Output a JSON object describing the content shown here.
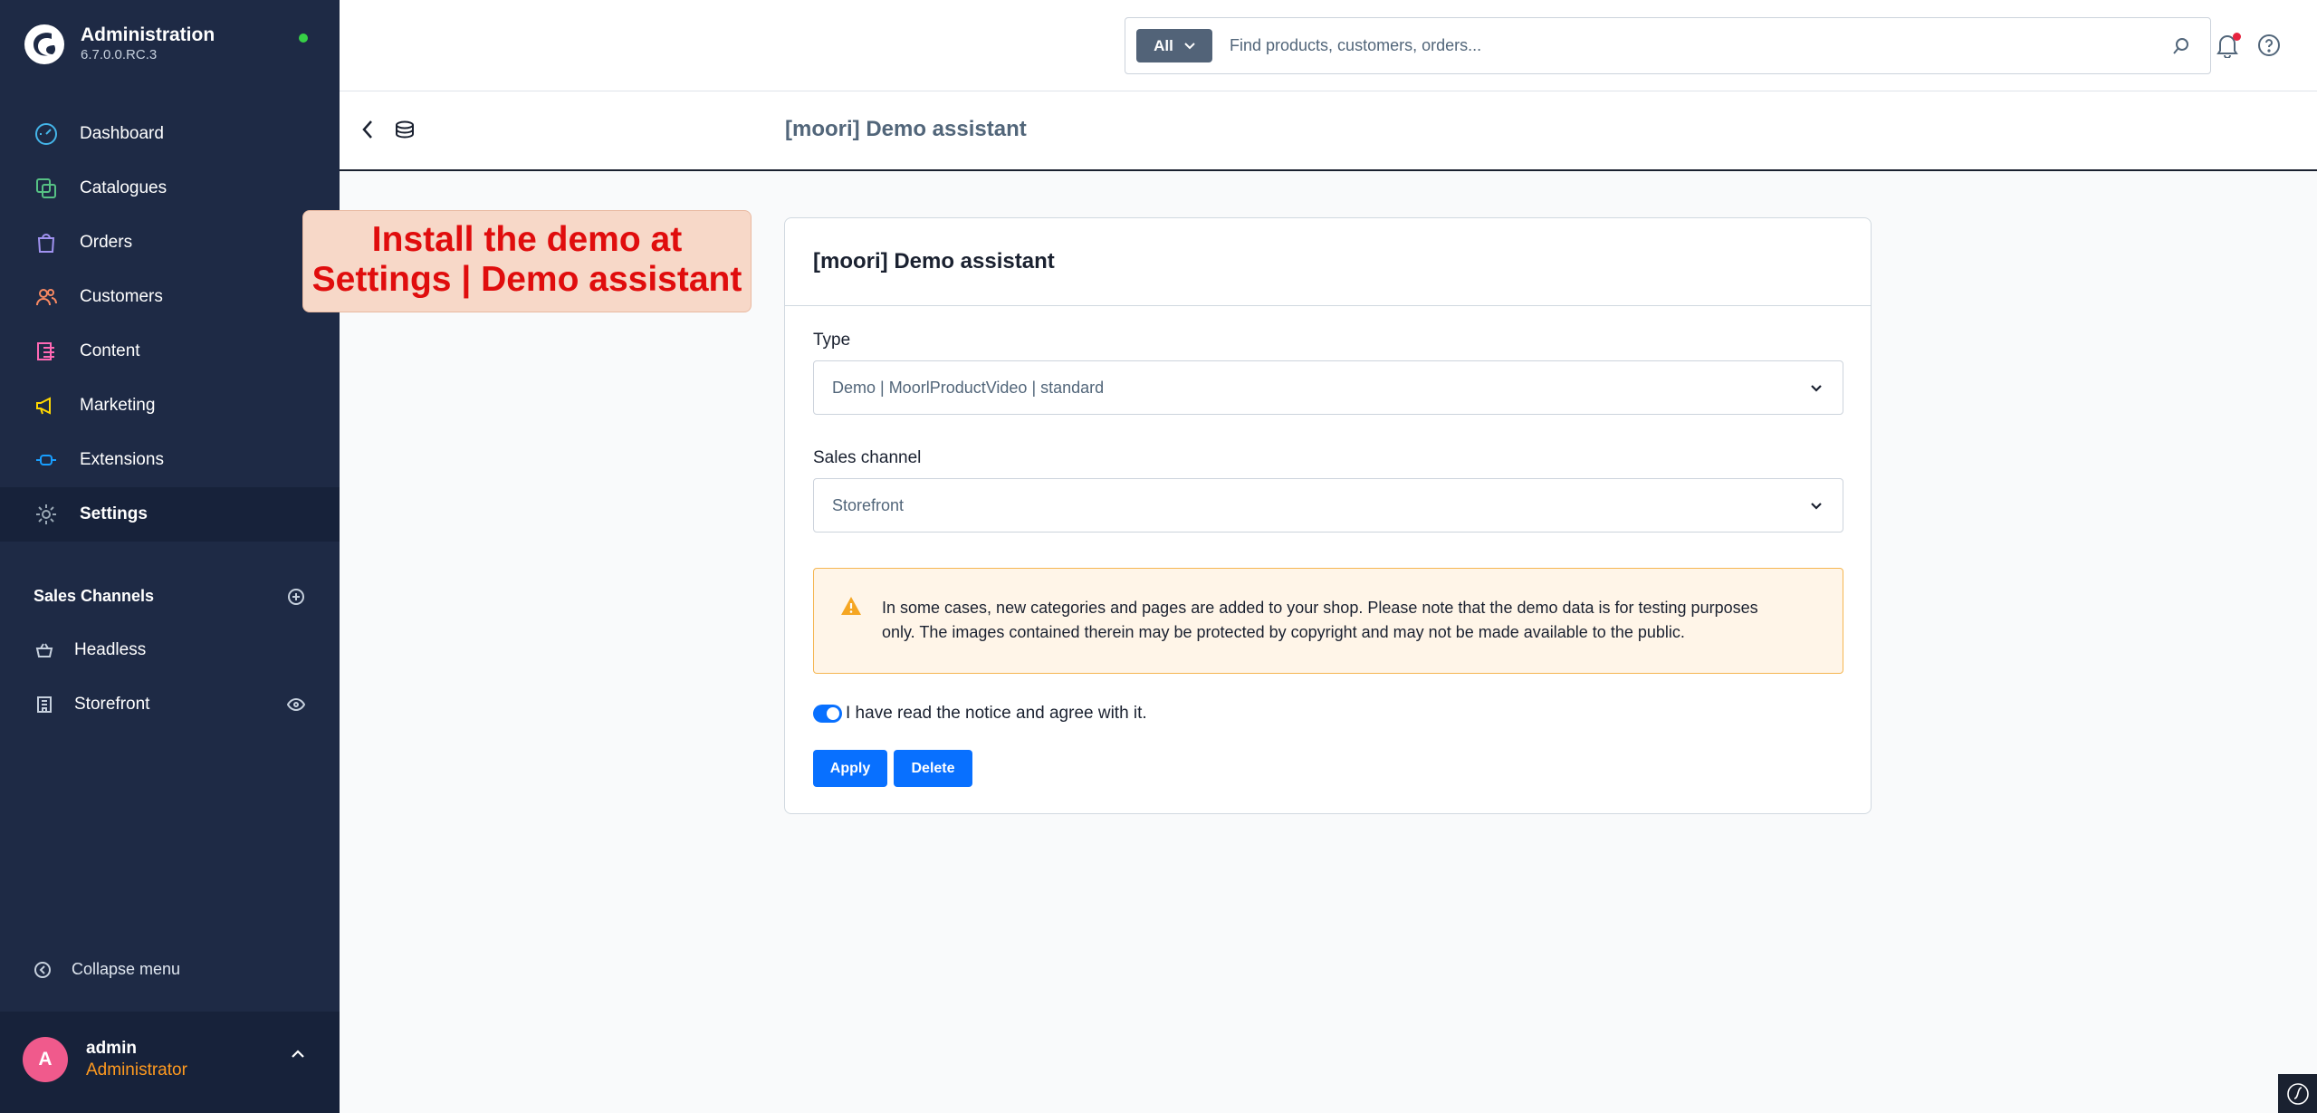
{
  "app": {
    "title": "Administration",
    "version": "6.7.0.0.RC.3",
    "status_color": "#37d046"
  },
  "nav": {
    "items": [
      {
        "label": "Dashboard",
        "icon": "gauge-icon",
        "color": "#44b5e9"
      },
      {
        "label": "Catalogues",
        "icon": "catalogue-icon",
        "color": "#56c184"
      },
      {
        "label": "Orders",
        "icon": "shopping-bag-icon",
        "color": "#a092f0"
      },
      {
        "label": "Customers",
        "icon": "users-icon",
        "color": "#f88962"
      },
      {
        "label": "Content",
        "icon": "content-icon",
        "color": "#ff68b4"
      },
      {
        "label": "Marketing",
        "icon": "megaphone-icon",
        "color": "#ffd700"
      },
      {
        "label": "Extensions",
        "icon": "plug-icon",
        "color": "#189eff"
      },
      {
        "label": "Settings",
        "icon": "gear-icon",
        "color": "#9aa8b5",
        "active": true
      }
    ]
  },
  "sales_channels": {
    "header": "Sales Channels",
    "items": [
      {
        "label": "Headless",
        "icon": "basket-icon"
      },
      {
        "label": "Storefront",
        "icon": "storefront-icon"
      }
    ]
  },
  "collapse_label": "Collapse menu",
  "user": {
    "initial": "A",
    "name": "admin",
    "role": "Administrator"
  },
  "search": {
    "type_label": "All",
    "placeholder": "Find products, customers, orders..."
  },
  "page": {
    "title": "[moori] Demo assistant"
  },
  "annotation": {
    "line1": "Install the demo at",
    "line2": "Settings | Demo assistant"
  },
  "card": {
    "title": "[moori] Demo assistant",
    "type_label": "Type",
    "type_value": "Demo | MoorlProductVideo | standard",
    "channel_label": "Sales channel",
    "channel_value": "Storefront",
    "notice_line1": "In some cases, new categories and pages are added to your shop. Please note that the demo data is for testing purposes",
    "notice_line2": "only. The images contained therein may be protected by copyright and may not be made available to the public.",
    "consent_label": "I have read the notice and agree with it.",
    "consent_checked": true,
    "apply_label": "Apply",
    "delete_label": "Delete"
  },
  "colors": {
    "primary": "#0870ff",
    "sidebar": "#1e2a45",
    "warning": "#f5b651",
    "annotation_text": "#e00d0d"
  }
}
